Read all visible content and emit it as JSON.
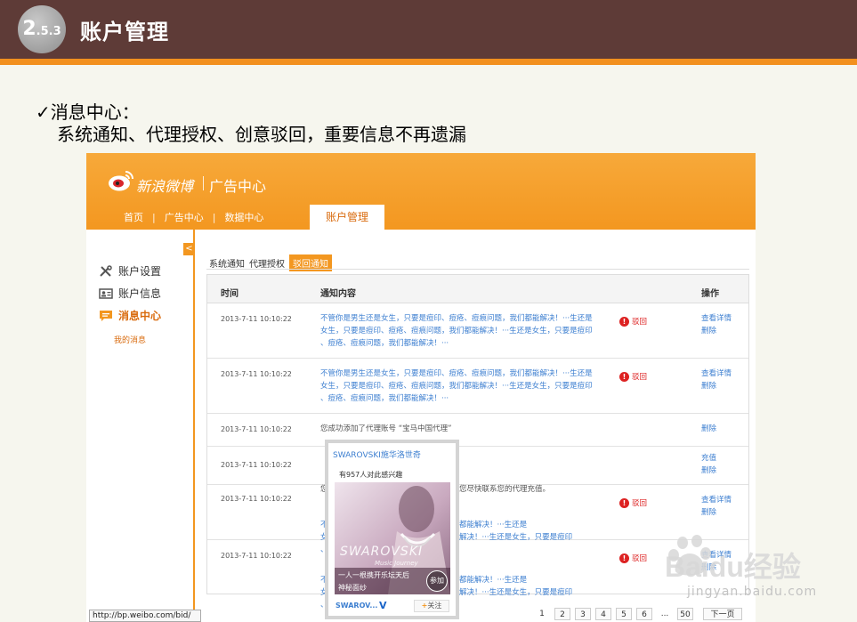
{
  "slide": {
    "section_number": "2",
    "section_number_small": ".5.3",
    "title": "账户管理",
    "bullet_check": "✓",
    "bullet_heading": "消息中心：",
    "bullet_sub": "系统通知、代理授权、创意驳回，重要信息不再遗漏"
  },
  "header": {
    "brand": "新浪微博",
    "sub_brand": "广告中心",
    "nav": [
      {
        "label": "首页"
      },
      {
        "label": "广告中心"
      },
      {
        "label": "数据中心"
      }
    ],
    "active_nav": "账户管理"
  },
  "sidebar": {
    "collapse_glyph": "<",
    "items": [
      {
        "label": "账户设置",
        "icon": "tools-icon"
      },
      {
        "label": "账户信息",
        "icon": "id-card-icon"
      },
      {
        "label": "消息中心",
        "icon": "message-icon"
      }
    ],
    "sub_item": "我的消息"
  },
  "tabs": [
    {
      "label": "系统通知"
    },
    {
      "label": "代理授权"
    },
    {
      "label": "驳回通知",
      "active": true
    }
  ],
  "table": {
    "headers": {
      "time": "时间",
      "content": "通知内容",
      "ops": "操作"
    },
    "rows": [
      {
        "time": "2013-7-11  10:10:22",
        "lines": [
          "不管你是男生还是女生，只要是痘印、痘疮、痘痕问题，我们都能解决！···生还是",
          "女生，只要是痘印、痘疮、痘痕问题，我们都能解决！···生还是女生，只要是痘印",
          "、痘疮、痘痕问题，我们都能解决！···"
        ],
        "reject": "驳回",
        "ops": [
          "查看详情",
          "删除"
        ]
      },
      {
        "time": "2013-7-11  10:10:22",
        "lines": [
          "不管你是男生还是女生，只要是痘印、痘疮、痘痕问题，我们都能解决！···生还是",
          "女生，只要是痘印、痘疮、痘痕问题，我们都能解决！···生还是女生，只要是痘印",
          "、痘疮、痘痕问题，我们都能解决！···"
        ],
        "reject": "驳回",
        "ops": [
          "查看详情",
          "删除"
        ]
      },
      {
        "time": "2013-7-11  10:10:22",
        "lines": [
          "您成功添加了代理账号 “宝马中国代理”"
        ],
        "ops": [
          "删除"
        ]
      },
      {
        "time": "2013-7-11  10:10:22",
        "lines": [
          "您                                          额，建议您尽快联系您的代理充值。"
        ],
        "ops": [
          "充值",
          "删除"
        ]
      },
      {
        "time": "2013-7-11  10:10:22",
        "lines": [
          "不                                          题，我们都能解决！···生还是",
          "女                                          我们都能解决！···生还是女生，只要是痘印",
          "、                                          ···"
        ],
        "reject": "驳回",
        "ops": [
          "查看详情",
          "删除"
        ]
      },
      {
        "time": "2013-7-11  10:10:22",
        "lines": [
          "不                                          题，我们都能解决！···生还是",
          "女                                          我们都能解决！···生还是女生，只要是痘印",
          "、"
        ],
        "reject": "驳回",
        "ops": [
          "查看详情",
          "删除"
        ]
      }
    ]
  },
  "pager": {
    "pages": [
      "1",
      "2",
      "3",
      "4",
      "5",
      "6"
    ],
    "ellipsis": "...",
    "last": "50",
    "next": "下一页"
  },
  "statusbar": "http://bp.weibo.com/bid/",
  "popup": {
    "title": "SWAROVSKI施华洛世奇",
    "count_text": "有957人对此感兴趣",
    "image_brand": "SWAROVSKI",
    "image_brand_sub": "Music Journey",
    "caption_line1": "一人一根携开乐坛天后",
    "caption_line2": "神秘面纱",
    "join": "参加",
    "foot_brand": "SWAROV...",
    "verified_mark": "V",
    "follow_plus": "+",
    "follow": "关注"
  },
  "watermark": {
    "brand": "Baidu经验",
    "url": "jingyan.baidu.com"
  },
  "colors": {
    "slide_header": "#5e3b37",
    "accent_orange": "#f39720",
    "link_blue": "#3d7fd0",
    "reject_red": "#dd2222"
  }
}
